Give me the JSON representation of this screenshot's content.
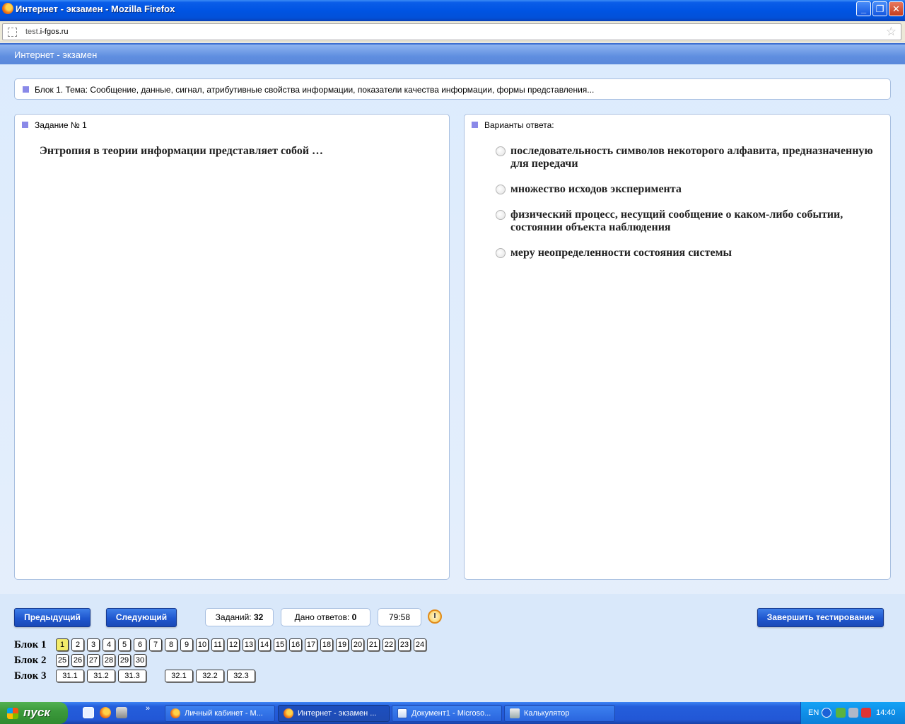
{
  "window": {
    "title": "Интернет - экзамен - Mozilla Firefox",
    "minimize": "_",
    "maximize": "❐",
    "close": "✕"
  },
  "browser": {
    "url_prefix": "test.",
    "url_domain": "i-fgos.ru"
  },
  "page": {
    "header": "Интернет - экзамен",
    "topic": "Блок 1. Тема: Сообщение, данные, сигнал, атрибутивные свойства информации, показатели качества информации, формы представления..."
  },
  "task": {
    "heading": "Задание № 1",
    "question": "Энтропия в теории информации представляет собой …"
  },
  "answers": {
    "heading": "Варианты ответа:",
    "options": [
      "последовательность символов некоторого алфавита, предназначенную для передачи",
      "множество исходов эксперимента",
      "физический процесс, несущий сообщение о каком-либо событии, состоянии объекта наблюдения",
      "меру неопределенности состояния системы"
    ]
  },
  "controls": {
    "prev": "Предыдущий",
    "next": "Следующий",
    "tasks_label": "Заданий:",
    "tasks_count": "32",
    "answered_label": "Дано ответов:",
    "answered_count": "0",
    "timer": "79:58",
    "finish": "Завершить тестирование"
  },
  "blocks": [
    {
      "label": "Блок 1",
      "items": [
        "1",
        "2",
        "3",
        "4",
        "5",
        "6",
        "7",
        "8",
        "9",
        "10",
        "11",
        "12",
        "13",
        "14",
        "15",
        "16",
        "17",
        "18",
        "19",
        "20",
        "21",
        "22",
        "23",
        "24"
      ]
    },
    {
      "label": "Блок 2",
      "items": [
        "25",
        "26",
        "27",
        "28",
        "29",
        "30"
      ]
    },
    {
      "label": "Блок 3",
      "items": [
        "31.1",
        "31.2",
        "31.3",
        "32.1",
        "32.2",
        "32.3"
      ]
    }
  ],
  "taskbar": {
    "start": "пуск",
    "chevron": "»",
    "tasks": [
      "Личный кабинет - М...",
      "Интернет - экзамен ...",
      "Документ1 - Microso...",
      "Калькулятор"
    ],
    "lang": "EN",
    "clock": "14:40"
  }
}
